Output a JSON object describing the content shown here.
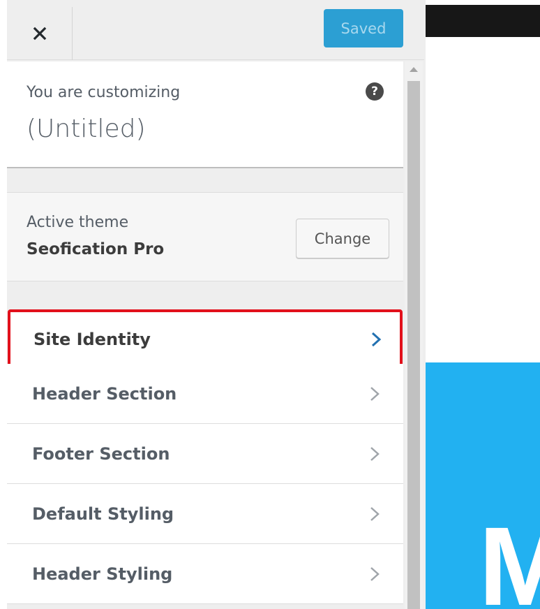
{
  "topbar": {
    "close_icon": "close-icon",
    "saved_label": "Saved"
  },
  "info": {
    "customizing_label": "You are customizing",
    "site_title": "(Untitled)",
    "help_icon": "help-icon",
    "help_glyph": "?"
  },
  "theme": {
    "active_label": "Active theme",
    "name": "Seofication Pro",
    "change_label": "Change"
  },
  "sections": [
    {
      "label": "Site Identity",
      "highlighted": true
    },
    {
      "label": "Header Section",
      "highlighted": false
    },
    {
      "label": "Footer Section",
      "highlighted": false
    },
    {
      "label": "Default Styling",
      "highlighted": false
    },
    {
      "label": "Header Styling",
      "highlighted": false
    }
  ],
  "preview": {
    "hero_text": "M"
  },
  "colors": {
    "saved_button": "#2c9fd3",
    "highlight_border": "#e2101b",
    "active_chevron": "#2271b1",
    "hero_background": "#22b1f1"
  }
}
